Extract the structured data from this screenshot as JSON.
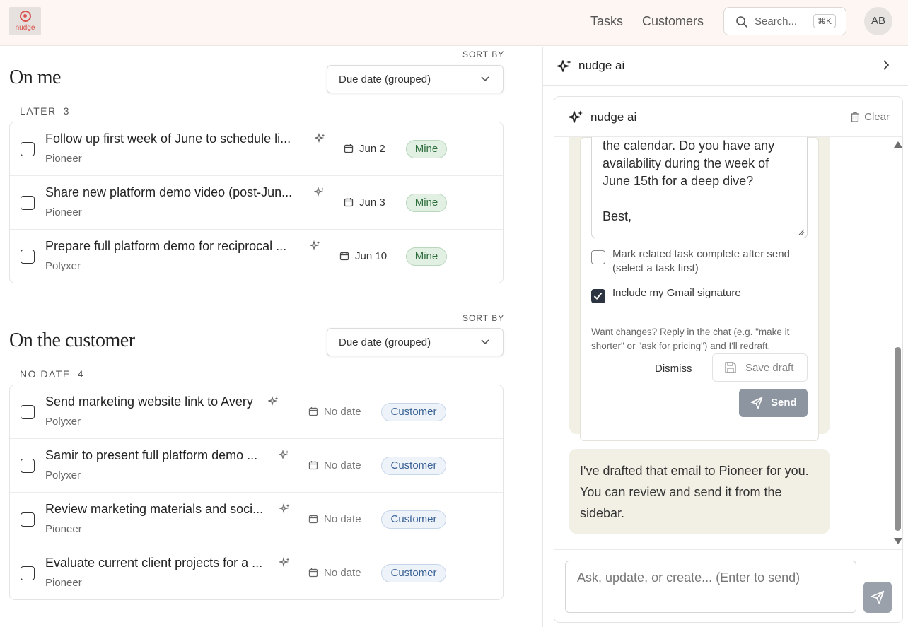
{
  "header": {
    "logo_text": "nudge",
    "nav": [
      "Tasks",
      "Customers"
    ],
    "search_placeholder": "Search...",
    "search_shortcut": "⌘K",
    "avatar_initials": "AB"
  },
  "on_me": {
    "title": "On me",
    "sort_label": "SORT BY",
    "sort_value": "Due date (grouped)",
    "group_label": "LATER",
    "group_count": "3",
    "tasks": [
      {
        "title": "Follow up first week of June to schedule li...",
        "account": "Pioneer",
        "due": "Jun 2",
        "owner": "Mine"
      },
      {
        "title": "Share new platform demo video (post-Jun...",
        "account": "Pioneer",
        "due": "Jun 3",
        "owner": "Mine"
      },
      {
        "title": "Prepare full platform demo for reciprocal ...",
        "account": "Polyxer",
        "due": "Jun 10",
        "owner": "Mine"
      }
    ]
  },
  "on_customer": {
    "title": "On the customer",
    "sort_label": "SORT BY",
    "sort_value": "Due date (grouped)",
    "group_label": "NO DATE",
    "group_count": "4",
    "tasks": [
      {
        "title": "Send marketing website link to Avery",
        "account": "Polyxer",
        "due": "No date",
        "owner": "Customer"
      },
      {
        "title": "Samir to present full platform demo ...",
        "account": "Polyxer",
        "due": "No date",
        "owner": "Customer"
      },
      {
        "title": "Review marketing materials and soci...",
        "account": "Pioneer",
        "due": "No date",
        "owner": "Customer"
      },
      {
        "title": "Evaluate current client projects for a ...",
        "account": "Pioneer",
        "due": "No date",
        "owner": "Customer"
      }
    ]
  },
  "ai_panel": {
    "outer_title": "nudge ai",
    "inner_title": "nudge ai",
    "clear_label": "Clear",
    "draft_lines": [
      "the calendar. Do you have any",
      "availability during the week of",
      "June 15th for a deep dive?",
      "",
      "Best,"
    ],
    "option_mark_complete": "Mark related task complete after send (select a task first)",
    "option_signature": "Include my Gmail signature",
    "hint": "Want changes? Reply in the chat (e.g. \"make it shorter\" or \"ask for pricing\") and I'll redraft.",
    "dismiss_label": "Dismiss",
    "save_draft_label": "Save draft",
    "send_label": "Send",
    "assistant_message": "I've drafted that email to Pioneer for you. You can review and send it from the sidebar.",
    "composer_placeholder": "Ask, update, or create... (Enter to send)"
  },
  "colors": {
    "header_bg": "#fdf6f2",
    "mine_badge_bg": "#e2f0e4",
    "mine_badge_text": "#2e6e3c",
    "customer_badge_bg": "#eef3fa",
    "customer_badge_text": "#3a6294",
    "bubble_bg": "#f2efe4",
    "send_button_bg": "#8d95a0"
  }
}
